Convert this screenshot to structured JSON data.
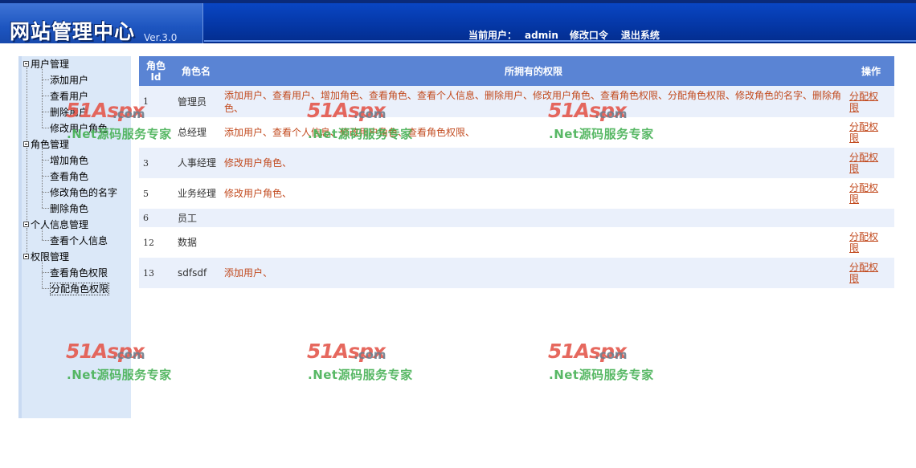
{
  "header": {
    "title": "网站管理中心",
    "version": "Ver.3.0",
    "current_user_label": "当前用户：",
    "current_user": "admin",
    "change_password": "修改口令",
    "logout": "退出系统"
  },
  "sidebar": {
    "groups": [
      {
        "label": "用户管理",
        "items": [
          "添加用户",
          "查看用户",
          "删除用户",
          "修改用户角色"
        ]
      },
      {
        "label": "角色管理",
        "items": [
          "增加角色",
          "查看角色",
          "修改角色的名字",
          "删除角色"
        ]
      },
      {
        "label": "个人信息管理",
        "items": [
          "查看个人信息"
        ]
      },
      {
        "label": "权限管理",
        "items": [
          "查看角色权限",
          "分配角色权限"
        ]
      }
    ]
  },
  "table": {
    "headers": {
      "id_line1": "角色",
      "id_line2": "Id",
      "name": "角色名",
      "perms": "所拥有的权限",
      "op": "操作"
    },
    "op_label": "分配权限",
    "rows": [
      {
        "id": "1",
        "name": "管理员",
        "perms": "添加用户、查看用户、增加角色、查看角色、查看个人信息、删除用户、修改用户角色、查看角色权限、分配角色权限、修改角色的名字、删除角色、",
        "op": "分配权限"
      },
      {
        "id": "",
        "name": "总经理",
        "perms": "添加用户、查看个人信息、修改用户角色、查看角色权限、",
        "op": "分配权限"
      },
      {
        "id": "3",
        "name": "人事经理",
        "perms": "修改用户角色、",
        "op": "分配权限"
      },
      {
        "id": "5",
        "name": "业务经理",
        "perms": "修改用户角色、",
        "op": "分配权限"
      },
      {
        "id": "6",
        "name": "员工",
        "perms": "",
        "op": ""
      },
      {
        "id": "12",
        "name": "数据",
        "perms": "",
        "op": "分配权限"
      },
      {
        "id": "13",
        "name": "sdfsdf",
        "perms": "添加用户、",
        "op": "分配权限"
      }
    ]
  },
  "watermark": {
    "brand": "51Aspx",
    "domain": ".com",
    "slogan": ".Net源码服务专家"
  },
  "colors": {
    "header_blue": "#0538a8",
    "table_header": "#5a84d4",
    "permission_text": "#c24a1e",
    "sidebar_bg": "#dbe8f8"
  }
}
